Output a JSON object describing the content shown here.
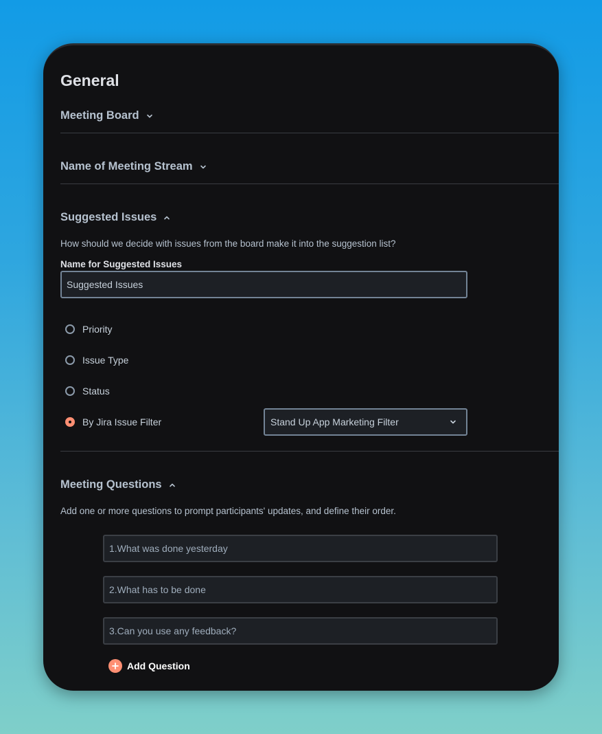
{
  "page": {
    "title": "General"
  },
  "sections": {
    "meeting_board": {
      "label": "Meeting Board"
    },
    "meeting_stream": {
      "label": "Name of Meeting Stream"
    },
    "suggested_issues": {
      "label": "Suggested Issues",
      "description": "How should we decide with issues from the board make it into the suggestion list?",
      "name_label": "Name for Suggested Issues",
      "name_value": "Suggested Issues",
      "options": [
        "Priority",
        "Issue Type",
        "Status",
        "By Jira Issue Filter"
      ],
      "selected_option": "By Jira Issue Filter",
      "filter_value": "Stand Up App Marketing Filter"
    },
    "meeting_questions": {
      "label": "Meeting Questions",
      "description": "Add one or more questions to prompt participants' updates, and define their order.",
      "questions": [
        "1.What was done yesterday",
        "2.What has to be done",
        "3.Can you use any feedback?"
      ],
      "add_label": "Add Question"
    }
  },
  "icons": {
    "chevron_down": "chevron-down-icon",
    "chevron_up": "chevron-up-icon",
    "plus": "plus-icon"
  },
  "colors": {
    "accent": "#ff8f73",
    "panel_bg": "#111113",
    "input_bg": "#1d2025"
  }
}
